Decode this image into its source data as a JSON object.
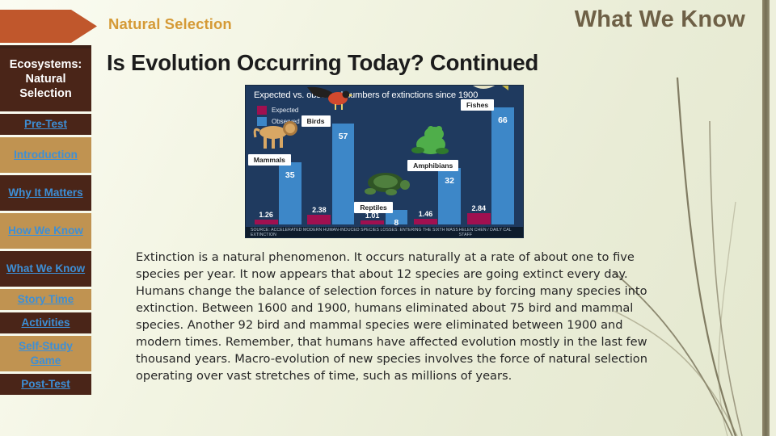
{
  "header": {
    "banner_label": "Natural Selection",
    "section_title": "What We Know"
  },
  "slide": {
    "title": "Is Evolution Occurring Today? Continued",
    "body": "Extinction is a natural phenomenon. It occurs naturally at a rate of about one to five species per year. It now appears that about 12 species are going extinct every day. Humans change the balance of selection forces in nature by forcing many species into extinction. Between 1600 and 1900, humans eliminated about 75 bird and mammal species. Another 92 bird and mammal species were eliminated between 1900 and modern times. Remember, that humans have affected evolution mostly in the last few thousand years. Macro-evolution of new species involves the force of natural selection operating over vast stretches of time, such as millions of years."
  },
  "sidebar": {
    "title": "Ecosystems: Natural Selection",
    "items": [
      {
        "label": "Pre-Test",
        "style": "dark"
      },
      {
        "label": "Introduction",
        "style": "tan"
      },
      {
        "label": "Why It Matters",
        "style": "dark"
      },
      {
        "label": "How We Know",
        "style": "tan"
      },
      {
        "label": "What We Know",
        "style": "dark"
      },
      {
        "label": "Story Time",
        "style": "tan"
      },
      {
        "label": "Activities",
        "style": "dark"
      },
      {
        "label": "Self-Study Game",
        "style": "tan"
      },
      {
        "label": "Post-Test",
        "style": "dark"
      }
    ]
  },
  "chart_data": {
    "type": "bar",
    "title": "Expected vs. observed numbers of extinctions since 1900",
    "xlabel": "",
    "ylabel": "",
    "ylim": [
      0,
      70
    ],
    "grid": false,
    "legend_position": "top-left",
    "categories": [
      "Mammals",
      "Birds",
      "Reptiles",
      "Amphibians",
      "Fishes"
    ],
    "series": [
      {
        "name": "Expected",
        "color": "#a01050",
        "values": [
          1.26,
          2.38,
          1.01,
          1.46,
          2.84
        ]
      },
      {
        "name": "Observed",
        "color": "#3d87c8",
        "values": [
          35,
          57,
          8,
          32,
          66
        ]
      }
    ],
    "value_labels": {
      "expected": [
        "1.26",
        "2.38",
        "1.01",
        "1.46",
        "2.84"
      ],
      "observed": [
        "35",
        "57",
        "8",
        "32",
        "66"
      ]
    },
    "source": "SOURCE: ACCELERATED MODERN HUMAN-INDUCED SPECIES LOSSES: ENTERING THE SIXTH MASS EXTINCTION",
    "credit": "HELEN CHEN / DAILY CAL STAFF",
    "background_color": "#1f3a5f"
  }
}
